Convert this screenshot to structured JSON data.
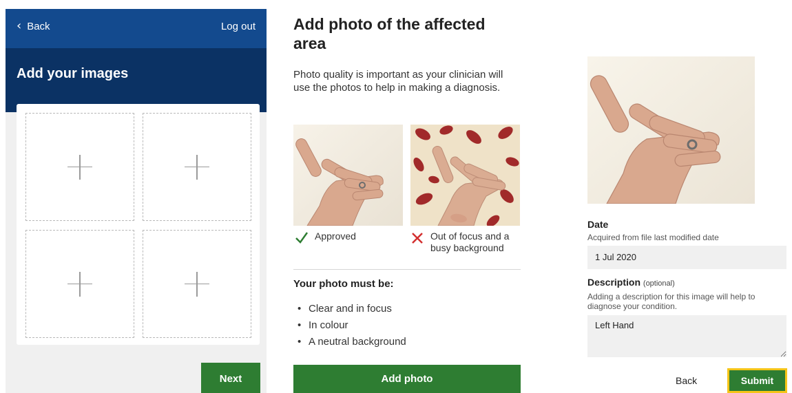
{
  "panel1": {
    "back_label": "Back",
    "logout_label": "Log out",
    "title": "Add your images",
    "slots_count_visible": 4,
    "next_label": "Next"
  },
  "panel2": {
    "title": "Add photo of the affected area",
    "intro": "Photo quality is important as your clinician will use the photos to help in making a diagnosis.",
    "examples": [
      {
        "caption": "Approved",
        "status_icon": "check-icon",
        "status_color": "#2e7d32"
      },
      {
        "caption": "Out of focus and a busy background",
        "status_icon": "cross-icon",
        "status_color": "#d32f2f"
      }
    ],
    "must_heading": "Your photo must be:",
    "requirements": [
      "Clear and in focus",
      "In colour",
      "A neutral background"
    ],
    "add_label": "Add photo"
  },
  "panel3": {
    "date_label": "Date",
    "date_help": "Acquired from file last modified date",
    "date_value": "1 Jul 2020",
    "description_label": "Description",
    "description_optional": "(optional)",
    "description_help": "Adding a description for this image will help to diagnose your condition.",
    "description_value": "Left Hand",
    "back_label": "Back",
    "submit_label": "Submit"
  },
  "colors": {
    "header_blue": "#134a8e",
    "title_band_blue": "#0b3264",
    "primary_green": "#2e7d32",
    "focus_yellow": "#f5c518"
  }
}
